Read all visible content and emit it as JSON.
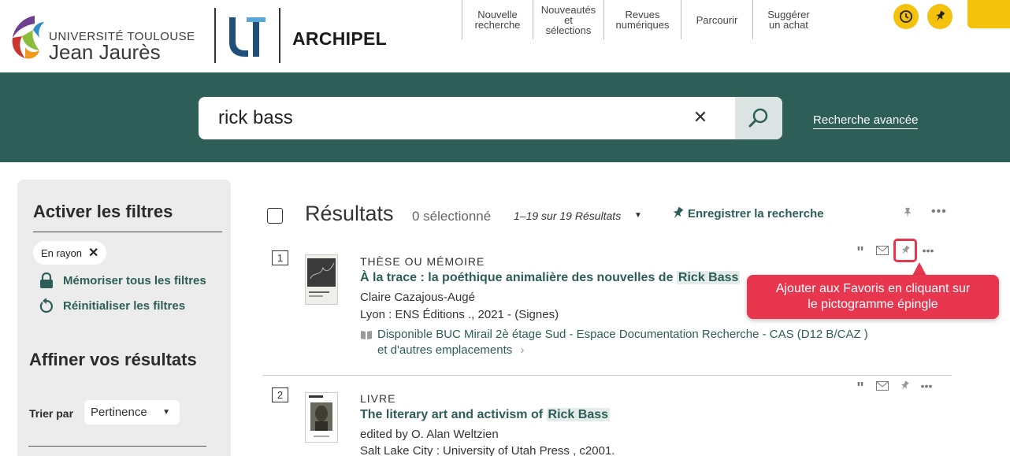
{
  "colors": {
    "primary": "#2d5e58",
    "accent": "#f4c20d",
    "highlight": "#e8364f"
  },
  "header": {
    "logo_line1": "UNIVERSITÉ TOULOUSE",
    "logo_line2": "Jean Jaurès",
    "brand": "ARCHIPEL",
    "nav": [
      {
        "label": "Nouvelle\nrecherche"
      },
      {
        "label": "Nouveautés\net\nsélections"
      },
      {
        "label": "Revues\nnumériques"
      },
      {
        "label": "Parcourir"
      },
      {
        "label": "Suggérer\nun achat"
      }
    ],
    "icons": [
      "history-icon",
      "pin-icon"
    ]
  },
  "search": {
    "value": "rick bass",
    "clear_icon": "close-icon",
    "submit_icon": "search-icon",
    "advanced_label": "Recherche avancée"
  },
  "sidebar": {
    "filters_title": "Activer les filtres",
    "active_chip": "En rayon",
    "actions": [
      {
        "icon": "lock-icon",
        "label": "Mémoriser tous les filtres"
      },
      {
        "icon": "reset-icon",
        "label": "Réinitialiser les filtres"
      }
    ],
    "refine_title": "Affiner vos résultats",
    "sort_label": "Trier par",
    "sort_value": "Pertinence"
  },
  "results": {
    "title": "Résultats",
    "selected": "0 sélectionné",
    "range": "1–19 sur 19 Résultats",
    "save_search": "Enregistrer la recherche",
    "items": [
      {
        "num": "1",
        "type": "THÈSE OU MÉMOIRE",
        "title_prefix": "À la trace : la poéthique animalière des nouvelles de",
        "title_hl": "Rick Bass",
        "author": "Claire Cazajous-Augé",
        "publisher": "Lyon : ENS Éditions ., 2021 - (Signes)",
        "availability": "Disponible BUC Mirail  2è étage Sud - Espace Documentation Recherche - CAS (D12 B/CAZ )",
        "more_locations": "et d'autres emplacements"
      },
      {
        "num": "2",
        "type": "LIVRE",
        "title_prefix": "The literary art and activism of",
        "title_hl": "Rick Bass",
        "author": "edited by O. Alan Weltzien",
        "publisher": "Salt Lake City : University of Utah Press , c2001."
      }
    ]
  },
  "tooltip": {
    "line1": "Ajouter aux Favoris en cliquant sur",
    "line2": "le pictogramme épingle"
  }
}
